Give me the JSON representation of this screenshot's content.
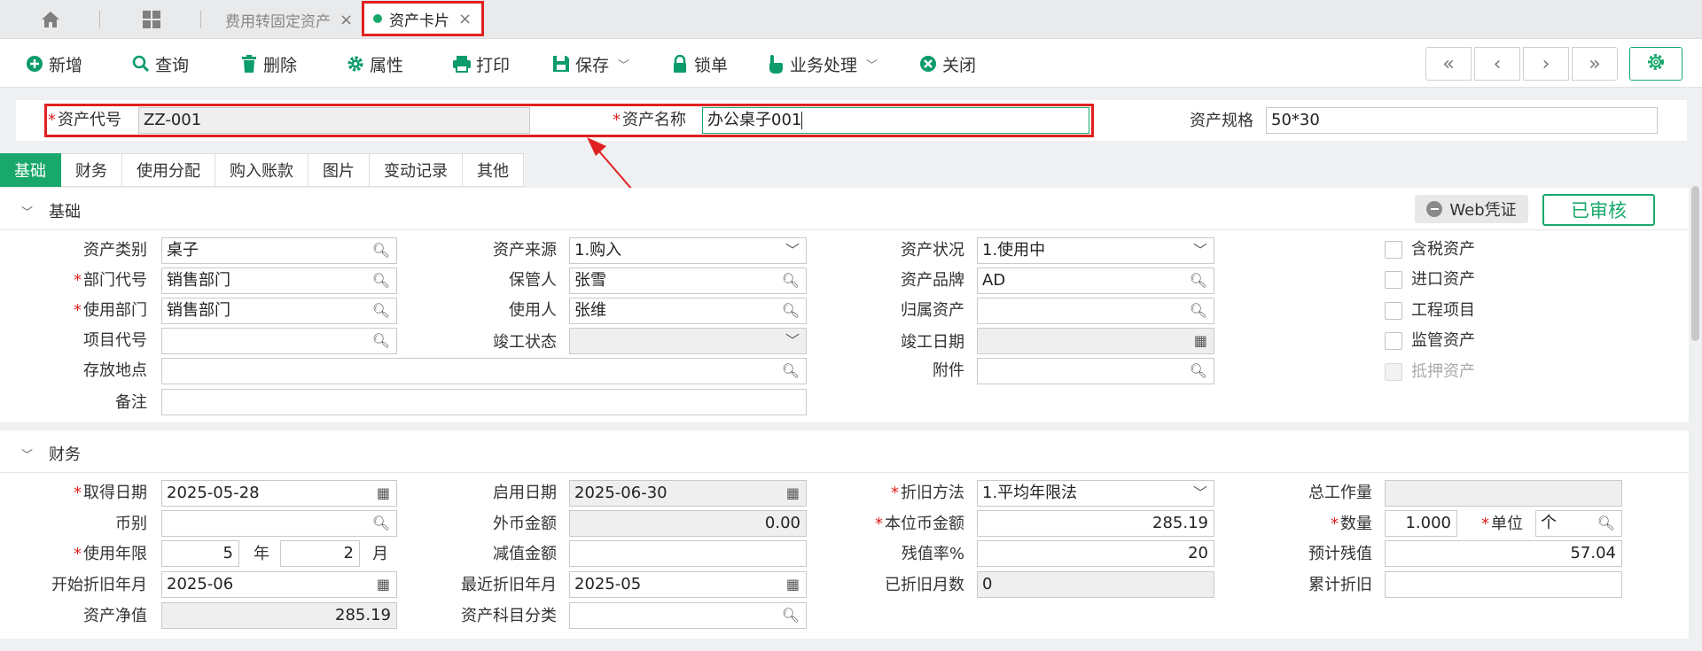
{
  "tabbar": {
    "home_icon": "home-icon",
    "apps_icon": "grid-icon",
    "tabs": [
      {
        "label": "费用转固定资产",
        "close": "×"
      },
      {
        "label": "资产卡片",
        "close": "×"
      }
    ]
  },
  "toolbar": {
    "new": "新增",
    "query": "查询",
    "delete": "删除",
    "props": "属性",
    "print": "打印",
    "save": "保存",
    "lock": "锁单",
    "business": "业务处理",
    "close": "关闭",
    "nav_first": "«",
    "nav_prev": "‹",
    "nav_next": "›",
    "nav_last": "»",
    "settings_icon": "gear-icon"
  },
  "header": {
    "asset_code_label": "资产代号",
    "asset_code": "ZZ-001",
    "asset_name_label": "资产名称",
    "asset_name": "办公桌子001",
    "asset_spec_label": "资产规格",
    "asset_spec": "50*30"
  },
  "subtabs": [
    "基础",
    "财务",
    "使用分配",
    "购入账款",
    "图片",
    "变动记录",
    "其他"
  ],
  "basic": {
    "title": "基础",
    "web_voucher": "Web凭证",
    "status": "已审核",
    "category_label": "资产类别",
    "category": "桌子",
    "source_label": "资产来源",
    "source": "1.购入",
    "condition_label": "资产状况",
    "condition": "1.使用中",
    "dept_code_label": "部门代号",
    "dept_code": "销售部门",
    "keeper_label": "保管人",
    "keeper": "张雪",
    "brand_label": "资产品牌",
    "brand": "AD",
    "use_dept_label": "使用部门",
    "use_dept": "销售部门",
    "user_label": "使用人",
    "user": "张维",
    "parent_label": "归属资产",
    "parent": "",
    "project_label": "项目代号",
    "project": "",
    "complete_status_label": "竣工状态",
    "complete_status": "",
    "complete_date_label": "竣工日期",
    "complete_date": "",
    "location_label": "存放地点",
    "location": "",
    "attachment_label": "附件",
    "attachment": "",
    "remark_label": "备注",
    "remark": "",
    "checks": [
      {
        "label": "含税资产",
        "disabled": false
      },
      {
        "label": "进口资产",
        "disabled": false
      },
      {
        "label": "工程项目",
        "disabled": false
      },
      {
        "label": "监管资产",
        "disabled": false
      },
      {
        "label": "抵押资产",
        "disabled": true
      }
    ]
  },
  "finance": {
    "title": "财务",
    "acq_date_label": "取得日期",
    "acq_date": "2025-05-28",
    "start_date_label": "启用日期",
    "start_date": "2025-06-30",
    "dep_method_label": "折旧方法",
    "dep_method": "1.平均年限法",
    "total_work_label": "总工作量",
    "total_work": "",
    "currency_label": "币别",
    "currency": "",
    "foreign_amt_label": "外币金额",
    "foreign_amt": "0.00",
    "local_amt_label": "本位币金额",
    "local_amt": "285.19",
    "qty_label": "数量",
    "qty": "1.000",
    "unit_label": "单位",
    "unit": "个",
    "life_label": "使用年限",
    "life_years": "5",
    "year_unit": "年",
    "life_months": "2",
    "month_unit": "月",
    "impair_label": "减值金额",
    "impair": "",
    "residual_rate_label": "残值率%",
    "residual_rate": "20",
    "est_residual_label": "预计残值",
    "est_residual": "57.04",
    "dep_start_label": "开始折旧年月",
    "dep_start": "2025-06",
    "last_dep_label": "最近折旧年月",
    "last_dep": "2025-05",
    "dep_months_label": "已折旧月数",
    "dep_months": "0",
    "accum_dep_label": "累计折旧",
    "accum_dep": "",
    "net_label": "资产净值",
    "net": "285.19",
    "subject_label": "资产科目分类",
    "subject": ""
  }
}
